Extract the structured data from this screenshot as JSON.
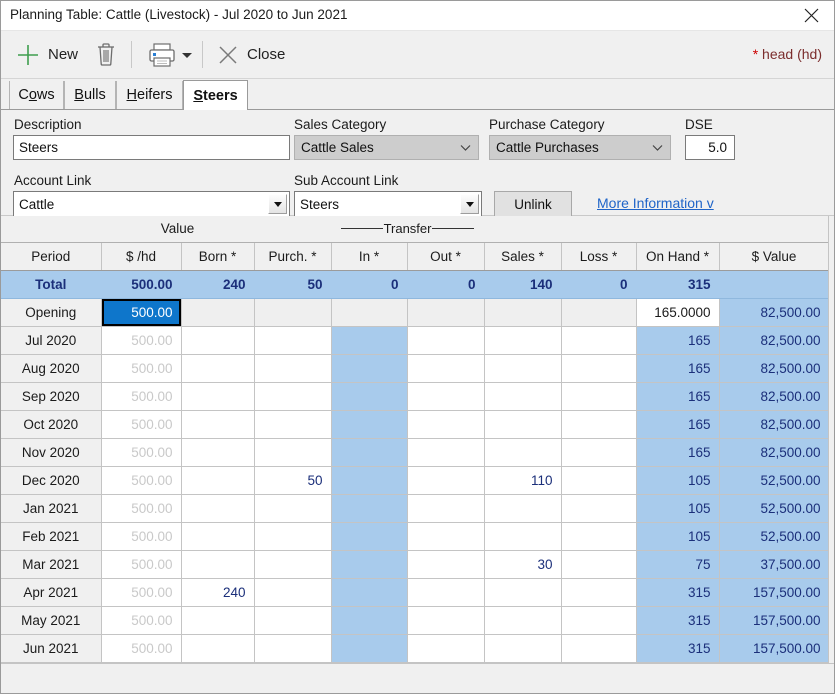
{
  "window": {
    "title": "Planning Table: Cattle (Livestock) - Jul 2020 to Jun 2021",
    "close_icon": "close-x-icon"
  },
  "toolbar": {
    "new_label": "New",
    "new_icon": "plus-icon",
    "delete_icon": "trash-icon",
    "print_icon": "printer-icon",
    "print_dropdown_icon": "caret-down-icon",
    "close_label": "Close",
    "close_icon": "x-icon",
    "units_note_asterisk": "*",
    "units_note": " head (hd)",
    "units_note_color": "#7b2d2d"
  },
  "tabs": [
    {
      "label": "Cows",
      "accel_before": "C",
      "accel": "o",
      "accel_after": "ws",
      "active": false
    },
    {
      "label": "Bulls",
      "accel_before": "",
      "accel": "B",
      "accel_after": "ulls",
      "active": false
    },
    {
      "label": "Heifers",
      "accel_before": "",
      "accel": "H",
      "accel_after": "eifers",
      "active": false
    },
    {
      "label": "Steers",
      "accel_before": "",
      "accel": "S",
      "accel_after": "teers",
      "active": true
    }
  ],
  "form": {
    "description_label": "Description",
    "description_value": "Steers",
    "sales_category_label": "Sales Category",
    "sales_category_value": "Cattle Sales",
    "purchase_category_label": "Purchase Category",
    "purchase_category_value": "Cattle Purchases",
    "dse_label": "DSE",
    "dse_value": "5.0",
    "account_link_label": "Account Link",
    "account_link_value": "Cattle",
    "sub_account_link_label": "Sub Account Link",
    "sub_account_link_value": "Steers",
    "unlink_label": "Unlink",
    "more_information_label": "More Information  v"
  },
  "grid": {
    "group_headers": {
      "value": "Value",
      "transfer": "Transfer"
    },
    "columns": [
      "Period",
      "$ /hd",
      "Born *",
      "Purch. *",
      "In *",
      "Out *",
      "Sales *",
      "Loss *",
      "On Hand *",
      "$ Value"
    ],
    "total_row": {
      "label": "Total",
      "rate": "500.00",
      "born": "240",
      "purch": "50",
      "in": "0",
      "out": "0",
      "sales": "140",
      "loss": "0",
      "on_hand": "315",
      "value": ""
    },
    "rows": [
      {
        "period": "Opening",
        "rate": "500.00",
        "born": "",
        "purch": "",
        "in": "",
        "out": "",
        "sales": "",
        "loss": "",
        "on_hand": "165.0000",
        "value": "82,500.00",
        "selected_rate": true,
        "opening": true
      },
      {
        "period": "Jul 2020",
        "rate": "500.00",
        "born": "",
        "purch": "",
        "in": "",
        "out": "",
        "sales": "",
        "loss": "",
        "on_hand": "165",
        "value": "82,500.00",
        "selected_rate": false,
        "opening": false
      },
      {
        "period": "Aug 2020",
        "rate": "500.00",
        "born": "",
        "purch": "",
        "in": "",
        "out": "",
        "sales": "",
        "loss": "",
        "on_hand": "165",
        "value": "82,500.00",
        "selected_rate": false,
        "opening": false
      },
      {
        "period": "Sep 2020",
        "rate": "500.00",
        "born": "",
        "purch": "",
        "in": "",
        "out": "",
        "sales": "",
        "loss": "",
        "on_hand": "165",
        "value": "82,500.00",
        "selected_rate": false,
        "opening": false
      },
      {
        "period": "Oct 2020",
        "rate": "500.00",
        "born": "",
        "purch": "",
        "in": "",
        "out": "",
        "sales": "",
        "loss": "",
        "on_hand": "165",
        "value": "82,500.00",
        "selected_rate": false,
        "opening": false
      },
      {
        "period": "Nov 2020",
        "rate": "500.00",
        "born": "",
        "purch": "",
        "in": "",
        "out": "",
        "sales": "",
        "loss": "",
        "on_hand": "165",
        "value": "82,500.00",
        "selected_rate": false,
        "opening": false
      },
      {
        "period": "Dec 2020",
        "rate": "500.00",
        "born": "",
        "purch": "50",
        "in": "",
        "out": "",
        "sales": "110",
        "loss": "",
        "on_hand": "105",
        "value": "52,500.00",
        "selected_rate": false,
        "opening": false
      },
      {
        "period": "Jan 2021",
        "rate": "500.00",
        "born": "",
        "purch": "",
        "in": "",
        "out": "",
        "sales": "",
        "loss": "",
        "on_hand": "105",
        "value": "52,500.00",
        "selected_rate": false,
        "opening": false
      },
      {
        "period": "Feb 2021",
        "rate": "500.00",
        "born": "",
        "purch": "",
        "in": "",
        "out": "",
        "sales": "",
        "loss": "",
        "on_hand": "105",
        "value": "52,500.00",
        "selected_rate": false,
        "opening": false
      },
      {
        "period": "Mar 2021",
        "rate": "500.00",
        "born": "",
        "purch": "",
        "in": "",
        "out": "",
        "sales": "30",
        "loss": "",
        "on_hand": "75",
        "value": "37,500.00",
        "selected_rate": false,
        "opening": false
      },
      {
        "period": "Apr 2021",
        "rate": "500.00",
        "born": "240",
        "purch": "",
        "in": "",
        "out": "",
        "sales": "",
        "loss": "",
        "on_hand": "315",
        "value": "157,500.00",
        "selected_rate": false,
        "opening": false
      },
      {
        "period": "May 2021",
        "rate": "500.00",
        "born": "",
        "purch": "",
        "in": "",
        "out": "",
        "sales": "",
        "loss": "",
        "on_hand": "315",
        "value": "157,500.00",
        "selected_rate": false,
        "opening": false
      },
      {
        "period": "Jun 2021",
        "rate": "500.00",
        "born": "",
        "purch": "",
        "in": "",
        "out": "",
        "sales": "",
        "loss": "",
        "on_hand": "315",
        "value": "157,500.00",
        "selected_rate": false,
        "opening": false
      }
    ]
  },
  "colors": {
    "accent_selection": "#0e76cb",
    "shade_blue": "#a8cbec",
    "value_text": "#1b2f7a",
    "link": "#1f64c8",
    "note_red": "#7b2d2d"
  }
}
